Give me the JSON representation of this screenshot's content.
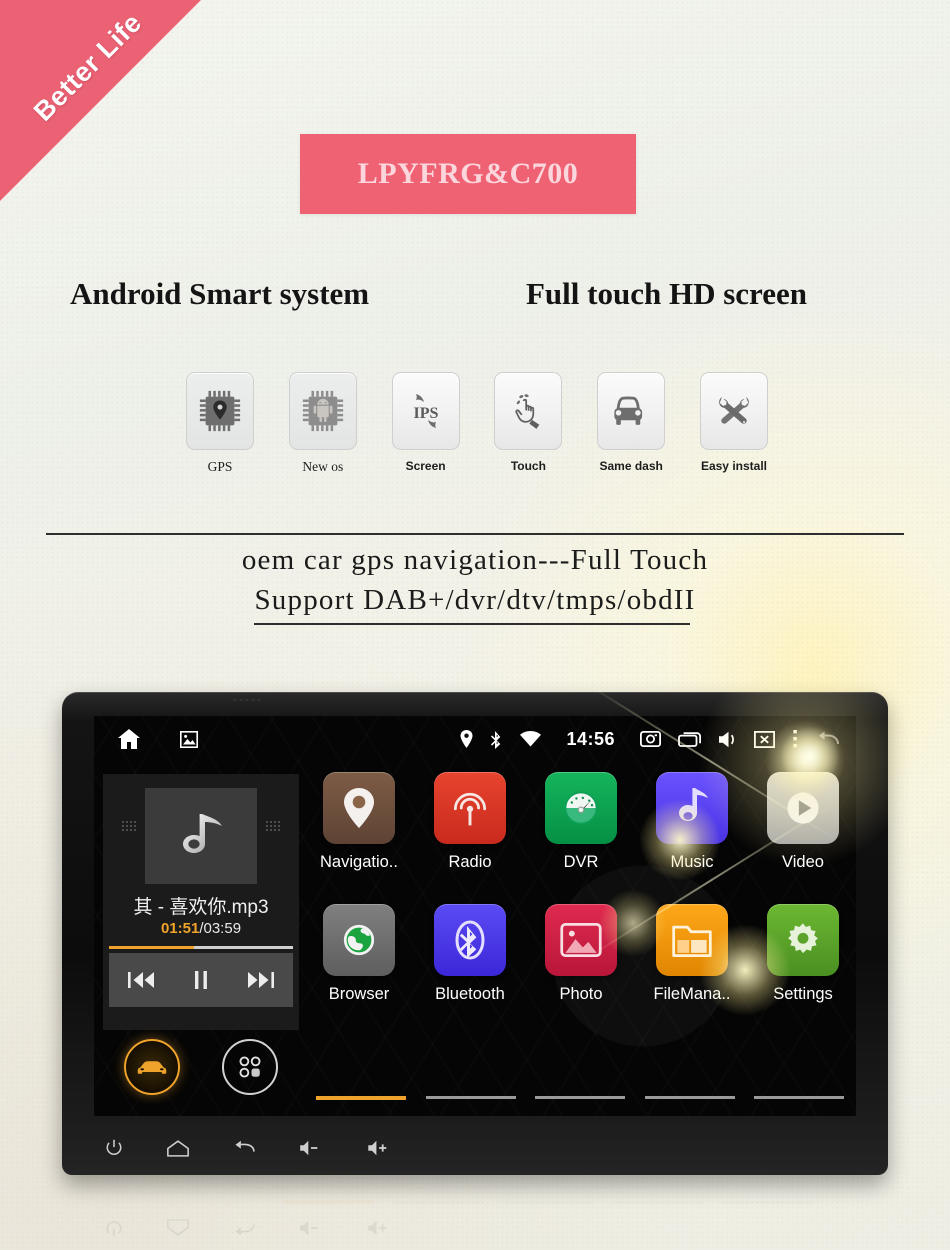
{
  "ribbon": {
    "text": "Better Life",
    "color": "#ea6274"
  },
  "banner": {
    "title": "LPYFRG&C700",
    "bg": "#ef6274",
    "text_color": "#fbd7dd"
  },
  "headings": {
    "left": "Android Smart system",
    "right": "Full touch HD screen"
  },
  "features": [
    {
      "label": "GPS",
      "icon": "chip-gps-icon",
      "font": "serif"
    },
    {
      "label": "New os",
      "icon": "chip-android-icon",
      "font": "serif"
    },
    {
      "label": "Screen",
      "icon": "ips-screen-icon",
      "font": "sans"
    },
    {
      "label": "Touch",
      "icon": "touch-hand-icon",
      "font": "sans"
    },
    {
      "label": "Same dash",
      "icon": "car-front-icon",
      "font": "sans"
    },
    {
      "label": "Easy install",
      "icon": "tools-icon",
      "font": "sans"
    }
  ],
  "tagline": {
    "line1": "oem car gps navigation---Full Touch",
    "line2": "Support DAB+/dvr/dtv/tmps/obdII"
  },
  "device": {
    "statusbar": {
      "left_icons": [
        "home-icon",
        "gallery-icon"
      ],
      "right_icons_before_clock": [
        "location-pin-icon",
        "bluetooth-icon",
        "wifi-icon"
      ],
      "clock": "14:56",
      "right_icons_after_clock": [
        "camera-icon",
        "recent-apps-icon",
        "volume-icon",
        "screen-off-icon",
        "overflow-menu-icon",
        "back-arrow-icon"
      ]
    },
    "music": {
      "album_icon": "music-note-icon",
      "track": "其 - 喜欢你.mp3",
      "elapsed": "01:51",
      "separator": "/",
      "duration": "03:59",
      "progress_percent": 46,
      "accent": "#f0a32a",
      "controls": [
        {
          "name": "previous-track-button",
          "glyph": "prev"
        },
        {
          "name": "pause-button",
          "glyph": "pause"
        },
        {
          "name": "next-track-button",
          "glyph": "next"
        }
      ],
      "shortcuts": [
        {
          "name": "car-mode-button",
          "icon": "car-icon",
          "active": true
        },
        {
          "name": "all-apps-button",
          "icon": "apps-grid-icon",
          "active": false
        }
      ]
    },
    "apps": [
      [
        {
          "label": "Navigatio..",
          "icon": "map-pin-icon",
          "bg": "#6d4f3d"
        },
        {
          "label": "Radio",
          "icon": "broadcast-icon",
          "bg": "#d93426"
        },
        {
          "label": "DVR",
          "icon": "gauge-icon",
          "bg": "#0ba04f"
        },
        {
          "label": "Music",
          "icon": "music-note-icon",
          "bg": "#5b46ef"
        },
        {
          "label": "Video",
          "icon": "play-icon",
          "bg": "#b9b9b9"
        }
      ],
      [
        {
          "label": "Browser",
          "icon": "globe-icon",
          "bg": "#6e6e6e"
        },
        {
          "label": "Bluetooth",
          "icon": "bluetooth-icon",
          "bg": "#4a3ce8"
        },
        {
          "label": "Photo",
          "icon": "image-icon",
          "bg": "#cf2044"
        },
        {
          "label": "FileMana..",
          "icon": "folder-icon",
          "bg": "#f2960d"
        },
        {
          "label": "Settings",
          "icon": "gear-icon",
          "bg": "#57a32a"
        }
      ]
    ],
    "page_indicator": {
      "count": 5,
      "active_index": 0,
      "active_color": "#f0a32a"
    },
    "bezel_buttons": [
      {
        "name": "power-button",
        "icon": "power-icon"
      },
      {
        "name": "home-button",
        "icon": "home-icon"
      },
      {
        "name": "back-button",
        "icon": "back-icon"
      },
      {
        "name": "volume-down-button",
        "icon": "volume-down-icon"
      },
      {
        "name": "volume-up-button",
        "icon": "volume-up-icon"
      }
    ]
  }
}
